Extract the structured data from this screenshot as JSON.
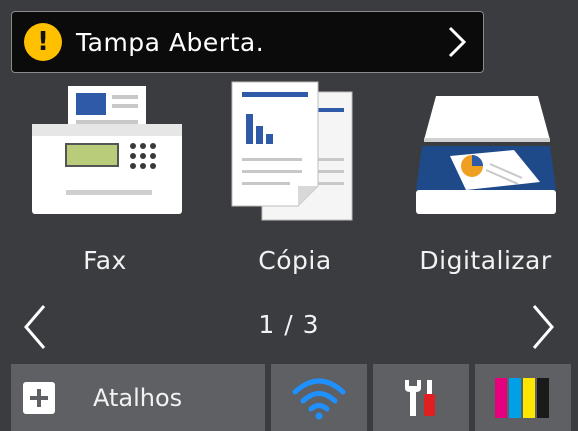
{
  "status": {
    "message": "Tampa Aberta.",
    "warning_icon": "exclamation-circle-icon",
    "warning_color": "#ffc000"
  },
  "tiles": [
    {
      "label": "Fax",
      "icon": "fax-machine-icon"
    },
    {
      "label": "Cópia",
      "icon": "copy-documents-icon"
    },
    {
      "label": "Digitalizar",
      "icon": "scanner-icon"
    }
  ],
  "pager": {
    "label": "1 / 3"
  },
  "bottom_bar": {
    "shortcuts_label": "Atalhos",
    "wifi_icon": "wifi-icon",
    "settings_icon": "tools-icon",
    "ink_icon": "ink-cartridges-icon",
    "ink_colors": [
      "#e6007e",
      "#00a0e9",
      "#ffe600",
      "#1a1a1a"
    ]
  },
  "colors": {
    "background": "#3a3c3f",
    "button": "#5e6064",
    "wifi_accent": "#1e90ff"
  }
}
